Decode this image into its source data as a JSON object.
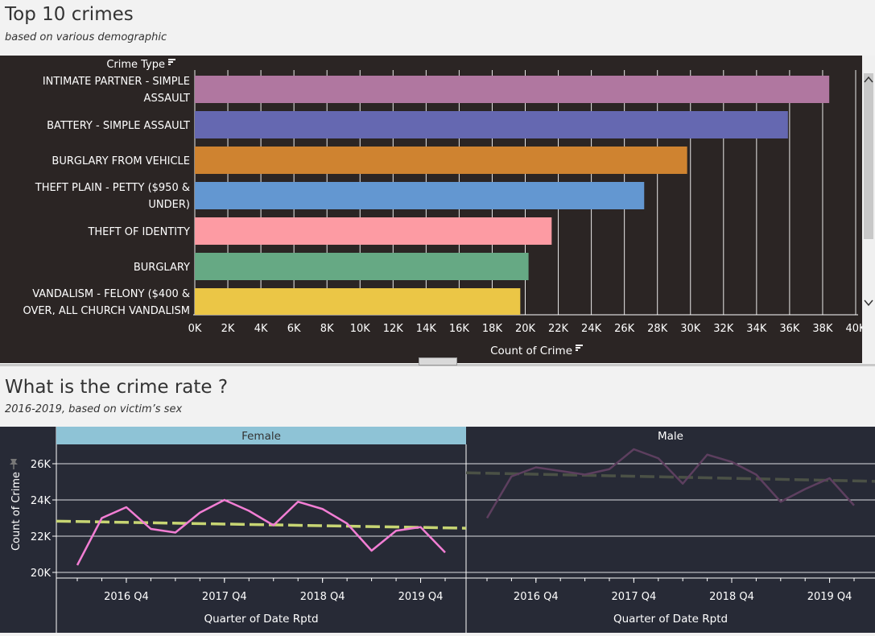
{
  "section1": {
    "title": "Top 10 crimes",
    "subtitle": "based on various demographic"
  },
  "section2": {
    "title": "What is the crime rate ?",
    "subtitle": "2016-2019, based on victim’s sex"
  },
  "icons": [
    "sort-icon",
    "scroll-up-icon",
    "scroll-down-icon",
    "pin-icon",
    "resize-grip-icon"
  ],
  "chart_data": [
    {
      "type": "bar",
      "orientation": "horizontal",
      "ylabel": "Crime Type",
      "xlabel": "Count of Crime",
      "xlim": [
        0,
        40000
      ],
      "ticks": [
        "0K",
        "2K",
        "4K",
        "6K",
        "8K",
        "10K",
        "12K",
        "14K",
        "16K",
        "18K",
        "20K",
        "22K",
        "24K",
        "26K",
        "28K",
        "30K",
        "32K",
        "34K",
        "36K",
        "38K",
        "40K"
      ],
      "categories": [
        [
          "INTIMATE PARTNER - SIMPLE",
          "ASSAULT"
        ],
        [
          "BATTERY - SIMPLE ASSAULT"
        ],
        [
          "BURGLARY FROM VEHICLE"
        ],
        [
          "THEFT PLAIN - PETTY ($950 &",
          "UNDER)"
        ],
        [
          "THEFT OF IDENTITY"
        ],
        [
          "BURGLARY"
        ],
        [
          "VANDALISM - FELONY ($400 &",
          "OVER, ALL CHURCH VANDALISM"
        ]
      ],
      "values": [
        38400,
        35900,
        29800,
        27200,
        21600,
        20200,
        19700
      ],
      "colors": [
        "#b077a0",
        "#6568b1",
        "#cf8330",
        "#6397d1",
        "#fd9ba3",
        "#66a984",
        "#ebc646"
      ],
      "grid": true
    },
    {
      "type": "line",
      "ylabel": "Count of Crime",
      "xlabel": "Quarter of Date Rptd",
      "ylim": [
        19500,
        27000
      ],
      "yticks": [
        "20K",
        "22K",
        "24K",
        "26K"
      ],
      "xticks": [
        "2016 Q4",
        "2017 Q4",
        "2018 Q4",
        "2019 Q4"
      ],
      "panels": [
        {
          "name": "Female",
          "color": "#f27ed4",
          "trend_color": "#c7d573",
          "values": [
            20400,
            23000,
            23600,
            22400,
            22200,
            23300,
            24000,
            23400,
            22600,
            23900,
            23500,
            22700,
            21200,
            22300,
            22500,
            21100
          ],
          "trend": [
            22830,
            22440
          ]
        },
        {
          "name": "Male",
          "color": "#5d3f5f",
          "trend_color": "#4b5146",
          "values": [
            23000,
            25300,
            25800,
            25600,
            25400,
            25700,
            26800,
            26300,
            24900,
            26500,
            26100,
            25400,
            23900,
            24600,
            25200,
            23700
          ],
          "trend": [
            25500,
            25030
          ]
        }
      ],
      "grid": true
    }
  ]
}
